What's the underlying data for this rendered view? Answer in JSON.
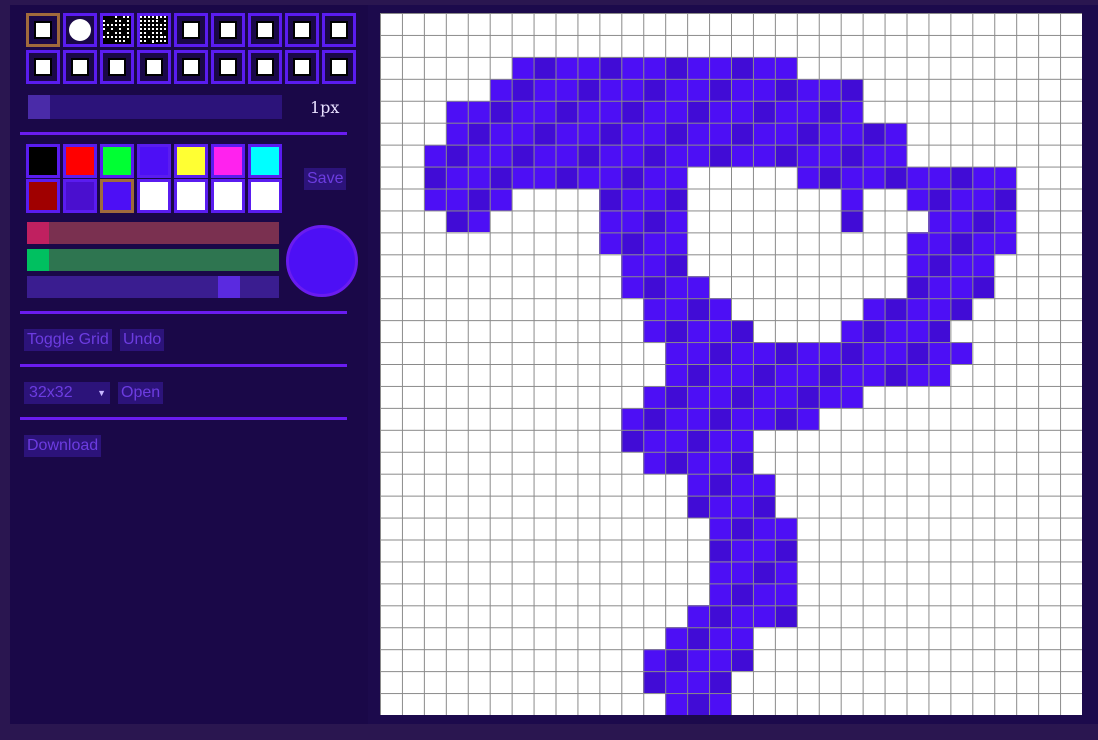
{
  "brushes": [
    {
      "icon": "square-brush-icon",
      "kind": "b-square",
      "selected": true
    },
    {
      "icon": "circle-brush-icon",
      "kind": "b-circle"
    },
    {
      "icon": "spray-brush-icon",
      "kind": "b-spray1"
    },
    {
      "icon": "scatter-brush-icon",
      "kind": "b-spray2"
    },
    {
      "icon": "square-brush-icon",
      "kind": "b-square"
    },
    {
      "icon": "square-brush-icon",
      "kind": "b-square"
    },
    {
      "icon": "square-brush-icon",
      "kind": "b-square"
    },
    {
      "icon": "square-brush-icon",
      "kind": "b-square"
    },
    {
      "icon": "square-brush-icon",
      "kind": "b-square"
    },
    {
      "icon": "square-brush-icon",
      "kind": "b-square"
    },
    {
      "icon": "square-brush-icon",
      "kind": "b-square"
    },
    {
      "icon": "square-brush-icon",
      "kind": "b-square"
    },
    {
      "icon": "square-brush-icon",
      "kind": "b-square"
    },
    {
      "icon": "square-brush-icon",
      "kind": "b-square"
    },
    {
      "icon": "square-brush-icon",
      "kind": "b-square"
    },
    {
      "icon": "square-brush-icon",
      "kind": "b-square"
    },
    {
      "icon": "square-brush-icon",
      "kind": "b-square"
    },
    {
      "icon": "square-brush-icon",
      "kind": "b-square"
    }
  ],
  "brush_size": {
    "label": "1px",
    "fraction": 0.0
  },
  "palette": [
    "#000000",
    "#ff0000",
    "#00ff33",
    "#4d0ff5",
    "#ffff33",
    "#ff22ee",
    "#00ffff",
    "#a00000",
    "#4a0fcf",
    "#4d0ff5",
    "#ffffff",
    "#ffffff",
    "#ffffff",
    "#ffffff"
  ],
  "palette_selected": 9,
  "buttons": {
    "save": "Save",
    "toggle_grid": "Toggle Grid",
    "undo": "Undo",
    "open": "Open",
    "download": "Download"
  },
  "color_sliders": [
    {
      "name": "red-slider",
      "track": "#7a3050",
      "thumb": "#c02060",
      "value": 0.0
    },
    {
      "name": "green-slider",
      "track": "#2e7550",
      "thumb": "#00c060",
      "value": 0.0
    },
    {
      "name": "blue-slider",
      "track": "#3a1d90",
      "thumb": "#5a2ae0",
      "value": 0.83
    }
  ],
  "current_color": "#4d0ff5",
  "grid_size": {
    "value": "32x32"
  },
  "colors": {
    "pixel": "#4d0ff5",
    "pixel_dark": "#410cd6",
    "accent_border": "#6a1cf0"
  },
  "canvas": {
    "cols": 32,
    "rows": 32,
    "pixels": [
      "................................",
      "................................",
      "......#############.............",
      ".....#################..........",
      "...###################.........",
      "...#####################........",
      "..######################.......",
      "..############.....##########...",
      "..####....####.......#..#####...",
      "...##.....####.......#...####...",
      "..........####..........#####...",
      "...........###..........####....",
      "...........####.........####....",
      "............####......#####.....",
      "............#####....#####.......",
      ".............##############.....",
      ".............#############......",
      "............##########..........",
      "...........#########............",
      "...........######...............",
      "............#####...............",
      "..............####..............",
      "..............####..............",
      "...............####.............",
      "...............####.............",
      "...............####.............",
      "...............####.............",
      "..............#####.............",
      ".............####...............",
      "............#####...............",
      "............####................",
      ".............###................"
    ]
  }
}
